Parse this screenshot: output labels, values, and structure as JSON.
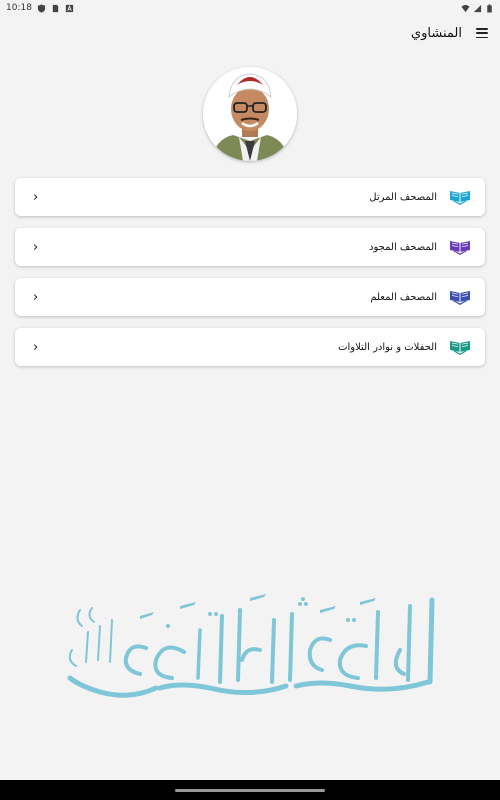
{
  "status_bar": {
    "time": "10:18",
    "icons": [
      "shield-icon",
      "sim-icon",
      "text-icon",
      "wifi-icon",
      "signal-icon",
      "battery-icon"
    ]
  },
  "app_bar": {
    "title": "المنشاوي",
    "menu_icon": "hamburger-menu-icon"
  },
  "avatar": {
    "description": "reciter-portrait"
  },
  "menu": {
    "items": [
      {
        "label": "المصحف المرتل",
        "icon_color": "#1aa5d6",
        "icon": "open-quran-icon"
      },
      {
        "label": "المصحف المجود",
        "icon_color": "#6a3ab7",
        "icon": "open-quran-icon"
      },
      {
        "label": "المصحف المعلم",
        "icon_color": "#3a4fb0",
        "icon": "open-quran-icon"
      },
      {
        "label": "الحفلات و نوادر التلاوات",
        "icon_color": "#1a9a86",
        "icon": "open-quran-icon"
      }
    ]
  },
  "calligraphy": {
    "text": "اقرأ باسم ربك الذي خلق",
    "color": "#7fc6d9"
  }
}
